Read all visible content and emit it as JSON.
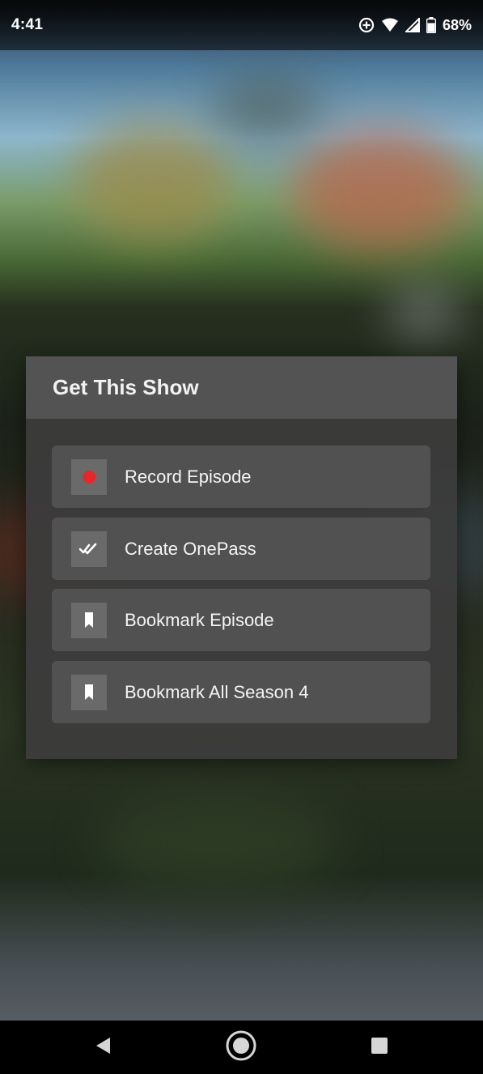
{
  "status_bar": {
    "time": "4:41",
    "battery": "68%",
    "icons": [
      "data-saver-icon",
      "wifi-icon",
      "cell-signal-icon",
      "battery-icon"
    ]
  },
  "dialog": {
    "title": "Get This Show",
    "options": [
      {
        "label": "Record Episode",
        "icon": "record-icon",
        "icon_color": "#e5262a"
      },
      {
        "label": "Create OnePass",
        "icon": "onepass-check-icon",
        "icon_color": "#ffffff"
      },
      {
        "label": "Bookmark Episode",
        "icon": "bookmark-icon",
        "icon_color": "#ffffff"
      },
      {
        "label": "Bookmark All Season 4",
        "icon": "bookmark-icon",
        "icon_color": "#ffffff"
      }
    ]
  },
  "navigation": {
    "buttons": [
      "back-icon",
      "home-icon",
      "recents-icon"
    ]
  },
  "colors": {
    "dialog_bg": "#3c3c3c",
    "header_bg": "#545454",
    "option_bg": "#525252",
    "record_red": "#e5262a"
  }
}
